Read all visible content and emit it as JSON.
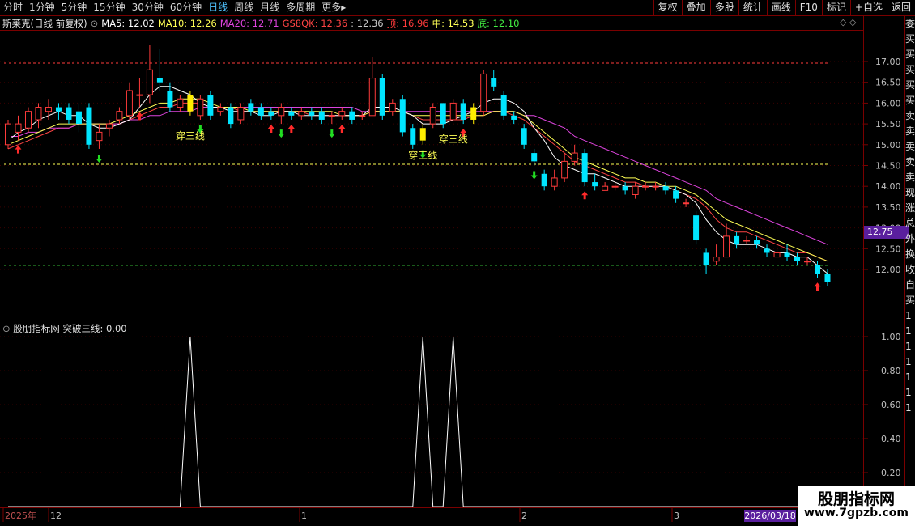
{
  "toolbar": {
    "periods": [
      "分时",
      "1分钟",
      "5分钟",
      "15分钟",
      "30分钟",
      "60分钟",
      "日线",
      "周线",
      "月线",
      "多周期",
      "更多▸"
    ],
    "active_period": "日线",
    "buttons": [
      "复权",
      "叠加",
      "多股",
      "统计",
      "画线",
      "F10",
      "标记",
      "+自选",
      "返回"
    ]
  },
  "info": {
    "stock": "斯莱克(日线 前复权)",
    "ma5": "MA5: 12.02",
    "ma10": "MA10: 12.26",
    "ma20": "MA20: 12.71",
    "gs8qk": "GS8QK: 12.36",
    "gs8qk2": ": 12.36",
    "top": "顶: 16.96",
    "mid": "中: 14.53",
    "bottom": "底: 12.10",
    "icons": "◇ ◇"
  },
  "colors": {
    "up": "#ff3b3b",
    "down": "#00e5ff",
    "ma5": "#ffffff",
    "ma10": "#ffff55",
    "ma20": "#dd44dd",
    "gs8qk": "#ff4444",
    "top": "#ff3b3b",
    "mid": "#ffff55",
    "bottom": "#44ee44"
  },
  "price_axis": [
    "17.00",
    "16.50",
    "16.00",
    "15.50",
    "15.00",
    "14.50",
    "14.00",
    "13.50",
    "13.00",
    "12.50",
    "12.00"
  ],
  "current_price": "12.75",
  "annotations": [
    "穿三线",
    "穿三线",
    "穿三线"
  ],
  "sub": {
    "title": "股朋指标网 突破三线: 0.00",
    "axis": [
      "1.00",
      "0.80",
      "0.60",
      "0.40",
      "0.20"
    ]
  },
  "dates": {
    "labels": [
      "2025年",
      "12",
      "1",
      "2",
      "3"
    ],
    "cursor": "2026/03/18"
  },
  "side_text": [
    "委",
    "买",
    "买",
    "买",
    "买",
    "买",
    "卖",
    "卖",
    "卖",
    "卖",
    "卖",
    "现",
    "涨",
    "总",
    "外",
    "换",
    "收",
    "自",
    "买",
    "1",
    "1",
    "1",
    "1",
    "1",
    "1",
    "1"
  ],
  "watermark": {
    "title": "股朋指标网",
    "url": "www.7gpzb.com"
  },
  "chart_data": {
    "type": "candlestick",
    "ylim": [
      11.5,
      17.5
    ],
    "levels": {
      "top": 16.96,
      "mid": 14.53,
      "bottom": 12.1
    },
    "candles": [
      [
        15.0,
        15.5,
        15.6,
        14.9
      ],
      [
        15.3,
        15.5,
        15.7,
        15.1
      ],
      [
        15.4,
        15.8,
        15.9,
        15.3
      ],
      [
        15.6,
        15.9,
        16.0,
        15.4
      ],
      [
        15.8,
        15.9,
        16.1,
        15.6
      ],
      [
        15.9,
        15.8,
        16.0,
        15.6
      ],
      [
        15.9,
        15.6,
        16.0,
        15.5
      ],
      [
        15.8,
        15.5,
        16.0,
        15.3
      ],
      [
        15.9,
        15.0,
        16.0,
        14.9
      ],
      [
        15.1,
        15.3,
        15.5,
        14.9
      ],
      [
        15.4,
        15.5,
        15.6,
        15.2
      ],
      [
        15.6,
        15.8,
        15.9,
        15.5
      ],
      [
        15.7,
        16.3,
        16.5,
        15.6
      ],
      [
        16.2,
        16.2,
        16.6,
        15.9
      ],
      [
        16.2,
        16.8,
        17.4,
        16.0
      ],
      [
        16.6,
        16.5,
        17.3,
        16.3
      ],
      [
        16.3,
        15.9,
        16.5,
        15.8
      ],
      [
        15.9,
        16.1,
        16.2,
        15.8
      ],
      [
        16.2,
        15.8,
        16.3,
        15.7
      ],
      [
        15.7,
        16.1,
        16.2,
        15.6
      ],
      [
        16.2,
        15.7,
        16.3,
        15.6
      ],
      [
        15.8,
        15.9,
        16.0,
        15.7
      ],
      [
        15.9,
        15.5,
        16.0,
        15.4
      ],
      [
        15.6,
        15.9,
        16.0,
        15.5
      ],
      [
        16.0,
        15.8,
        16.1,
        15.7
      ],
      [
        15.9,
        15.7,
        16.0,
        15.6
      ],
      [
        15.8,
        15.7,
        15.9,
        15.6
      ],
      [
        15.7,
        15.9,
        16.0,
        15.5
      ],
      [
        15.8,
        15.7,
        15.9,
        15.6
      ],
      [
        15.7,
        15.8,
        15.9,
        15.6
      ],
      [
        15.8,
        15.7,
        15.9,
        15.6
      ],
      [
        15.8,
        15.6,
        15.9,
        15.5
      ],
      [
        15.7,
        15.7,
        15.8,
        15.5
      ],
      [
        15.7,
        15.8,
        15.9,
        15.6
      ],
      [
        15.8,
        15.6,
        15.9,
        15.5
      ],
      [
        15.7,
        15.7,
        15.8,
        15.6
      ],
      [
        15.7,
        16.6,
        17.1,
        15.7
      ],
      [
        16.6,
        15.7,
        16.7,
        15.6
      ],
      [
        15.8,
        16.0,
        16.1,
        15.7
      ],
      [
        16.1,
        15.3,
        16.2,
        15.2
      ],
      [
        15.4,
        15.0,
        15.5,
        14.9
      ],
      [
        15.1,
        15.4,
        15.5,
        15.0
      ],
      [
        15.5,
        15.9,
        16.0,
        15.4
      ],
      [
        16.0,
        15.5,
        16.0,
        15.4
      ],
      [
        15.6,
        16.0,
        16.1,
        15.6
      ],
      [
        16.0,
        15.6,
        16.1,
        15.5
      ],
      [
        15.6,
        15.9,
        16.0,
        15.5
      ],
      [
        15.8,
        16.7,
        16.8,
        15.7
      ],
      [
        16.6,
        16.4,
        16.8,
        16.3
      ],
      [
        16.2,
        15.7,
        16.3,
        15.6
      ],
      [
        15.7,
        15.6,
        15.8,
        15.5
      ],
      [
        15.4,
        15.0,
        15.5,
        14.9
      ],
      [
        14.8,
        14.6,
        14.9,
        14.5
      ],
      [
        14.3,
        14.0,
        14.4,
        13.9
      ],
      [
        14.0,
        14.2,
        14.4,
        13.9
      ],
      [
        14.2,
        14.6,
        14.8,
        14.1
      ],
      [
        14.6,
        14.8,
        15.0,
        14.5
      ],
      [
        14.8,
        14.1,
        14.9,
        14.0
      ],
      [
        14.1,
        14.0,
        14.3,
        13.9
      ],
      [
        13.9,
        14.0,
        14.1,
        13.9
      ],
      [
        14.0,
        14.0,
        14.1,
        13.9
      ],
      [
        14.0,
        13.9,
        14.1,
        13.8
      ],
      [
        13.8,
        14.0,
        14.1,
        13.7
      ],
      [
        14.0,
        14.0,
        14.1,
        13.9
      ],
      [
        14.0,
        14.0,
        14.1,
        13.9
      ],
      [
        14.0,
        13.9,
        14.1,
        13.8
      ],
      [
        13.9,
        13.7,
        14.0,
        13.6
      ],
      [
        13.6,
        13.6,
        13.7,
        13.5
      ],
      [
        13.3,
        12.7,
        13.4,
        12.6
      ],
      [
        12.4,
        12.1,
        12.5,
        11.9
      ],
      [
        12.2,
        12.3,
        12.6,
        12.1
      ],
      [
        12.3,
        12.8,
        13.1,
        12.3
      ],
      [
        12.8,
        12.6,
        12.9,
        12.5
      ],
      [
        12.7,
        12.7,
        12.8,
        12.6
      ],
      [
        12.7,
        12.6,
        12.8,
        12.5
      ],
      [
        12.5,
        12.4,
        12.6,
        12.3
      ],
      [
        12.3,
        12.4,
        12.6,
        12.3
      ],
      [
        12.4,
        12.3,
        12.6,
        12.2
      ],
      [
        12.3,
        12.2,
        12.4,
        12.1
      ],
      [
        12.2,
        12.2,
        12.3,
        12.1
      ],
      [
        12.1,
        11.9,
        12.2,
        11.8
      ],
      [
        11.9,
        11.7,
        12.0,
        11.6
      ]
    ],
    "ma5": [
      15.1,
      15.3,
      15.4,
      15.6,
      15.7,
      15.8,
      15.7,
      15.7,
      15.5,
      15.4,
      15.4,
      15.5,
      15.6,
      15.9,
      16.2,
      16.4,
      16.4,
      16.3,
      16.2,
      16.0,
      15.9,
      15.9,
      15.8,
      15.8,
      15.8,
      15.7,
      15.7,
      15.8,
      15.8,
      15.7,
      15.7,
      15.7,
      15.7,
      15.7,
      15.7,
      15.7,
      15.9,
      15.9,
      15.9,
      15.8,
      15.7,
      15.5,
      15.5,
      15.5,
      15.6,
      15.7,
      15.8,
      16.0,
      16.1,
      16.1,
      16.0,
      15.8,
      15.4,
      15.1,
      14.7,
      14.5,
      14.4,
      14.3,
      14.3,
      14.2,
      14.1,
      14.0,
      14.0,
      14.0,
      14.0,
      14.0,
      13.9,
      13.8,
      13.6,
      13.2,
      12.9,
      12.7,
      12.6,
      12.6,
      12.6,
      12.5,
      12.4,
      12.4,
      12.3,
      12.3,
      12.1,
      11.9
    ],
    "ma10": [
      15.0,
      15.1,
      15.2,
      15.3,
      15.4,
      15.5,
      15.5,
      15.5,
      15.5,
      15.5,
      15.5,
      15.6,
      15.7,
      15.8,
      15.9,
      16.0,
      16.0,
      16.1,
      16.1,
      16.1,
      16.0,
      15.9,
      15.9,
      15.9,
      15.8,
      15.8,
      15.8,
      15.8,
      15.8,
      15.8,
      15.8,
      15.8,
      15.8,
      15.7,
      15.7,
      15.7,
      15.8,
      15.8,
      15.8,
      15.8,
      15.7,
      15.7,
      15.7,
      15.7,
      15.7,
      15.7,
      15.7,
      15.7,
      15.8,
      15.8,
      15.8,
      15.7,
      15.5,
      15.3,
      15.1,
      14.9,
      14.7,
      14.6,
      14.5,
      14.4,
      14.3,
      14.2,
      14.2,
      14.1,
      14.1,
      14.0,
      14.0,
      13.9,
      13.8,
      13.6,
      13.4,
      13.2,
      13.1,
      13.0,
      12.9,
      12.8,
      12.7,
      12.6,
      12.5,
      12.4,
      12.3,
      12.2
    ],
    "ma20": [
      15.2,
      15.2,
      15.3,
      15.3,
      15.4,
      15.4,
      15.4,
      15.5,
      15.5,
      15.5,
      15.5,
      15.5,
      15.6,
      15.6,
      15.7,
      15.7,
      15.8,
      15.8,
      15.8,
      15.9,
      15.9,
      15.9,
      15.9,
      15.9,
      15.9,
      15.9,
      15.9,
      15.9,
      15.9,
      15.9,
      15.9,
      15.9,
      15.9,
      15.9,
      15.9,
      15.8,
      15.8,
      15.8,
      15.8,
      15.8,
      15.8,
      15.8,
      15.8,
      15.8,
      15.8,
      15.8,
      15.8,
      15.8,
      15.8,
      15.8,
      15.8,
      15.7,
      15.7,
      15.6,
      15.5,
      15.4,
      15.2,
      15.1,
      15.0,
      14.9,
      14.8,
      14.7,
      14.6,
      14.5,
      14.4,
      14.3,
      14.2,
      14.1,
      14.0,
      13.9,
      13.7,
      13.6,
      13.5,
      13.4,
      13.3,
      13.2,
      13.1,
      13.0,
      12.9,
      12.8,
      12.7,
      12.6
    ],
    "gs8qk": [
      14.9,
      15.0,
      15.1,
      15.2,
      15.3,
      15.4,
      15.4,
      15.5,
      15.5,
      15.5,
      15.5,
      15.5,
      15.6,
      15.7,
      15.8,
      15.9,
      15.9,
      16.0,
      16.0,
      16.0,
      15.9,
      15.9,
      15.9,
      15.8,
      15.8,
      15.8,
      15.8,
      15.8,
      15.8,
      15.8,
      15.7,
      15.7,
      15.7,
      15.7,
      15.7,
      15.7,
      15.8,
      15.8,
      15.8,
      15.8,
      15.7,
      15.6,
      15.6,
      15.6,
      15.6,
      15.6,
      15.7,
      15.7,
      15.8,
      15.8,
      15.7,
      15.6,
      15.4,
      15.2,
      15.0,
      14.8,
      14.6,
      14.5,
      14.4,
      14.3,
      14.2,
      14.1,
      14.1,
      14.0,
      14.0,
      14.0,
      13.9,
      13.8,
      13.7,
      13.5,
      13.2,
      13.0,
      12.9,
      12.9,
      12.8,
      12.7,
      12.6,
      12.5,
      12.4,
      12.4,
      12.3,
      12.2
    ],
    "arrows_up": [
      1,
      13,
      26,
      28,
      33,
      45,
      57,
      80
    ],
    "arrows_down": [
      9,
      19,
      27,
      32,
      41,
      52
    ],
    "highlight_candles": [
      18,
      41,
      46
    ],
    "signal_spikes": [
      18,
      41,
      44
    ],
    "signal_values_label": "突破三线"
  }
}
